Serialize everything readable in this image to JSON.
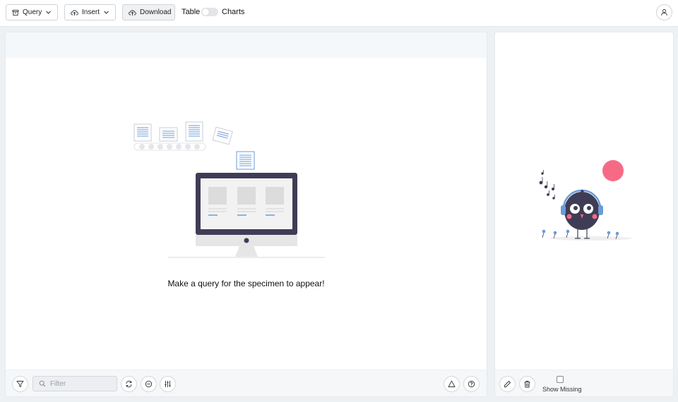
{
  "toolbar": {
    "query_label": "Query",
    "insert_label": "Insert",
    "download_label": "Download",
    "table_label": "Table",
    "charts_label": "Charts",
    "view_toggle_on": false
  },
  "main": {
    "empty_message": "Make a query for the specimen to appear!",
    "filter_placeholder": "Filter"
  },
  "side": {
    "show_missing_label": "Show Missing",
    "show_missing_checked": false
  },
  "colors": {
    "accent_blue": "#6b9bd8",
    "monitor_dark": "#3f3d56",
    "sun_pink": "#f76a85"
  },
  "icons": [
    "archive-icon",
    "chevron-down-icon",
    "upload-cloud-icon",
    "download-cloud-icon",
    "user-icon",
    "funnel-icon",
    "search-icon",
    "refresh-icon",
    "minus-circle-icon",
    "sliders-icon",
    "warning-icon",
    "help-icon",
    "pencil-icon",
    "trash-icon"
  ]
}
